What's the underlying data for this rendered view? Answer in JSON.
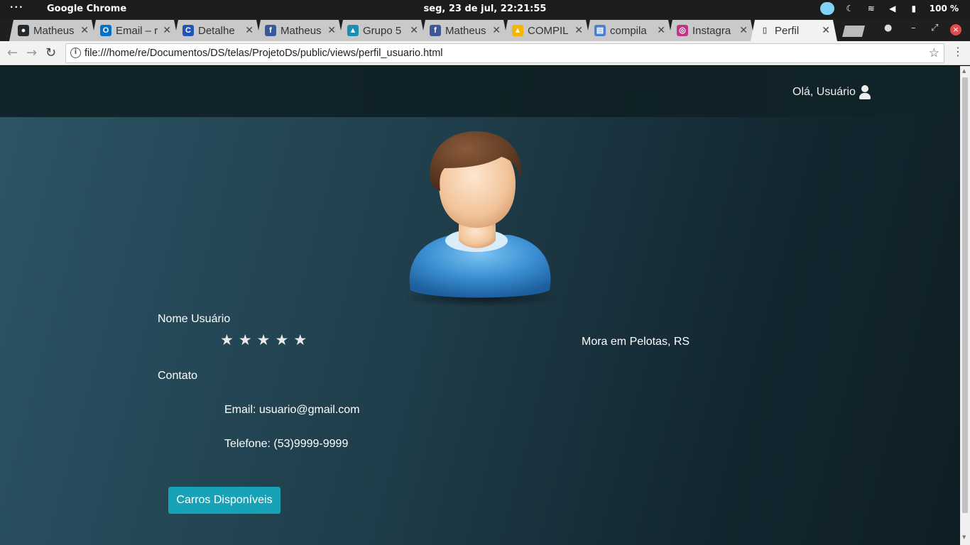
{
  "system_bar": {
    "activities": "···",
    "app_name": "Google Chrome",
    "datetime": "seg, 23 de jul, 22:21:55",
    "battery": "100 %"
  },
  "tabs": [
    {
      "title": "Matheus",
      "favicon": "github-icon",
      "color": "#24292e"
    },
    {
      "title": "Email – r",
      "favicon": "outlook-icon",
      "color": "#0072c6"
    },
    {
      "title": "Detalhe",
      "favicon": "carrefour-icon",
      "color": "#1f55b5"
    },
    {
      "title": "Matheus",
      "favicon": "facebook-icon",
      "color": "#3b5998"
    },
    {
      "title": "Grupo 5",
      "favicon": "sail-icon",
      "color": "#1a8fb0"
    },
    {
      "title": "Matheus",
      "favicon": "facebook-icon",
      "color": "#3b5998"
    },
    {
      "title": "COMPIL",
      "favicon": "google-drive-icon",
      "color": "#f4b400"
    },
    {
      "title": "compila",
      "favicon": "google-docs-icon",
      "color": "#4a7fd0"
    },
    {
      "title": "Instagra",
      "favicon": "instagram-icon",
      "color": "#c13584"
    },
    {
      "title": "Perfil",
      "favicon": "page-icon",
      "color": "#ffffff",
      "active": true
    }
  ],
  "omnibox": {
    "url": "file:///home/re/Documentos/DS/telas/ProjetoDs/public/views/perfil_usuario.html"
  },
  "page": {
    "greeting": "Olá, Usuário",
    "user_name": "Nome Usuário",
    "rating": 5,
    "location": "Mora em Pelotas, RS",
    "contact_heading": "Contato",
    "email": "Email: usuario@gmail.com",
    "phone": "Telefone: (53)9999-9999",
    "button_label": "Carros Disponíveis"
  },
  "colors": {
    "accent_button": "#17a2b8",
    "navbar": "#10252b",
    "page_gradient_start": "#2c5566",
    "page_gradient_end": "#0f1e25"
  }
}
